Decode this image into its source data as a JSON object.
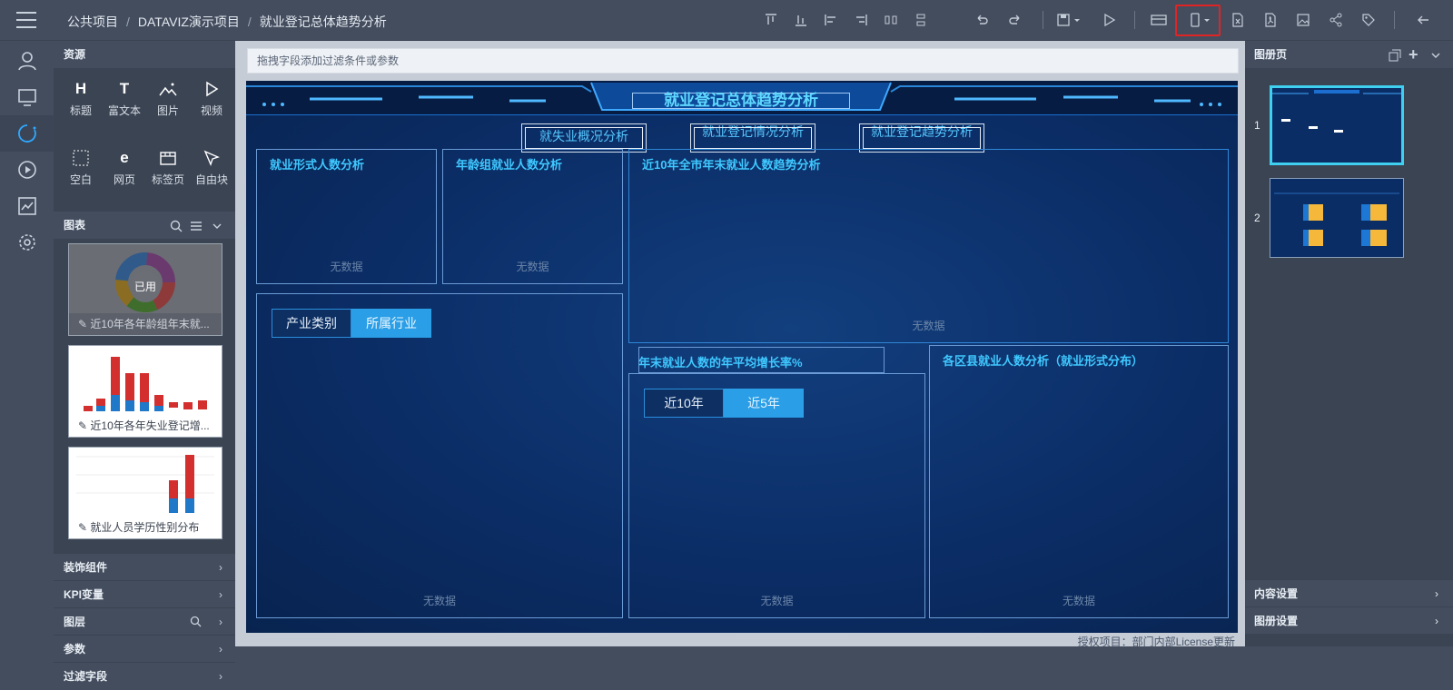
{
  "breadcrumb": {
    "root": "公共项目",
    "sep": "/",
    "project": "DATAVIZ演示项目",
    "current": "就业登记总体趋势分析"
  },
  "toolbar": {
    "highlighted": "mobile-view-button"
  },
  "left_panel": {
    "resources_title": "资源",
    "resources": [
      {
        "label": "标题",
        "icon": "H"
      },
      {
        "label": "富文本",
        "icon": "T"
      },
      {
        "label": "图片",
        "icon": "image-icon"
      },
      {
        "label": "视频",
        "icon": "video-icon"
      },
      {
        "label": "空白",
        "icon": "blank-icon"
      },
      {
        "label": "网页",
        "icon": "e"
      },
      {
        "label": "标签页",
        "icon": "tab-icon"
      },
      {
        "label": "自由块",
        "icon": "free-block-icon"
      }
    ],
    "charts_title": "图表",
    "used_badge": "已用",
    "charts": [
      {
        "caption": "近10年各年龄组年末就..."
      },
      {
        "caption": "近10年各年失业登记增..."
      },
      {
        "caption": "就业人员学历性别分布"
      }
    ],
    "sections": [
      "装饰组件",
      "KPI变量",
      "图层",
      "参数",
      "过滤字段"
    ]
  },
  "canvas": {
    "filter_placeholder": "拖拽字段添加过滤条件或参数",
    "title": "就业登记总体趋势分析",
    "tabs": [
      "就失业概况分析",
      "就业登记情况分析",
      "就业登记趋势分析"
    ],
    "panels": {
      "form": "就业形式人数分析",
      "age": "年龄组就业人数分析",
      "trend": "近10年全市年末就业人数趋势分析",
      "growth": "年末就业人数的年平均增长率%",
      "county": "各区县就业人数分析（就业形式分布）"
    },
    "no_data": "无数据",
    "seg1": [
      "产业类别",
      "所属行业"
    ],
    "seg2": [
      "近10年",
      "近5年"
    ],
    "license": "授权项目：部门内部License更新"
  },
  "right_panel": {
    "title": "图册页",
    "pages": [
      "1",
      "2"
    ],
    "footer": [
      "内容设置",
      "图册设置"
    ]
  },
  "colors": {
    "accent": "#3fc8ff",
    "highlight": "#e02424",
    "dash_bg": "#0b2d66"
  }
}
